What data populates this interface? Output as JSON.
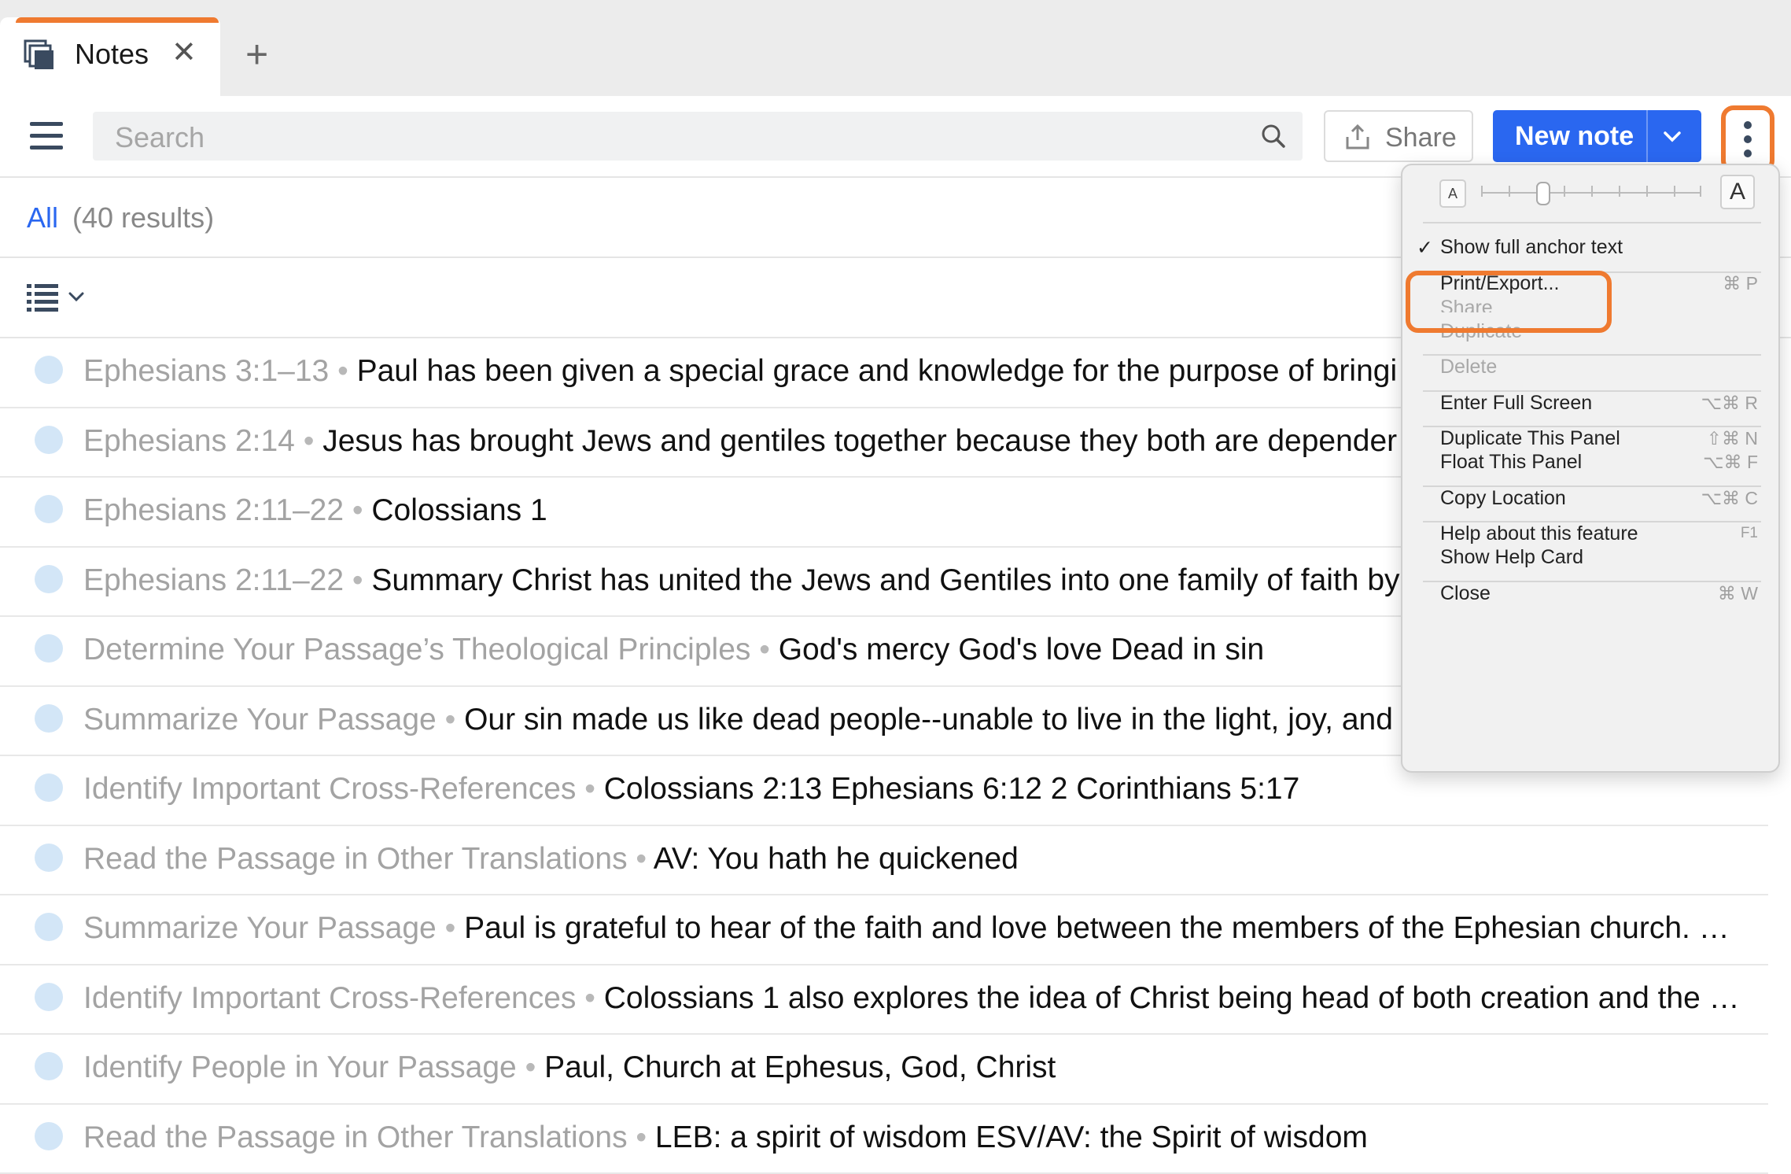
{
  "colors": {
    "accent_orange": "#ef7a30",
    "primary_blue": "#2a67f0",
    "anchor_gray": "#a3a3a3",
    "status_circle": "#d3e6f7"
  },
  "tab": {
    "title": "Notes",
    "icon": "notes-stack-icon",
    "close": "✕",
    "add": "+"
  },
  "toolbar": {
    "menu_icon": "hamburger-icon",
    "search_placeholder": "Search",
    "search_icon": "search-icon",
    "share_label": "Share",
    "share_icon": "share-upload-icon",
    "new_note_label": "New note",
    "new_note_dropdown_icon": "chevron-down-icon",
    "more_icon": "vertical-ellipsis-icon"
  },
  "filter": {
    "all_label": "All",
    "count": "(40 results)",
    "view_icon": "list-view-icon"
  },
  "notes": [
    {
      "anchor": "Ephesians 3:1–13",
      "content": "Paul has been given a special grace and knowledge for the purpose of bringi"
    },
    {
      "anchor": "Ephesians 2:14",
      "content": "Jesus has brought Jews and gentiles together because they both are depender"
    },
    {
      "anchor": "Ephesians 2:11–22",
      "content": "Colossians 1"
    },
    {
      "anchor": "Ephesians 2:11–22",
      "content": "Summary Christ has united the Jews and Gentiles into one family of faith by"
    },
    {
      "anchor": "Determine Your Passage’s Theological Principles",
      "content": "God's mercy God's love Dead in sin"
    },
    {
      "anchor": "Summarize Your Passage",
      "content": "Our sin made us like dead people--unable to live in the light, joy, and"
    },
    {
      "anchor": "Identify Important Cross-References",
      "content": "Colossians 2:13 Ephesians 6:12 2 Corinthians 5:17"
    },
    {
      "anchor": "Read the Passage in Other Translations",
      "content": "AV: You hath he quickened"
    },
    {
      "anchor": "Summarize Your Passage",
      "content": "Paul is grateful to hear of the faith and love between the members of the Ephesian church. …"
    },
    {
      "anchor": "Identify Important Cross-References",
      "content": "Colossians 1 also explores the idea of Christ being head of both creation and the …"
    },
    {
      "anchor": "Identify People in Your Passage",
      "content": "Paul, Church at Ephesus, God, Christ"
    },
    {
      "anchor": "Read the Passage in Other Translations",
      "content": "LEB: a spirit of wisdom ESV/AV: the Spirit of wisdom"
    }
  ],
  "menu": {
    "zoom_small": "A",
    "zoom_large": "A",
    "show_anchor": {
      "check": "✓",
      "label": "Show full anchor text"
    },
    "print_export": {
      "label": "Print/Export...",
      "shortcut": "⌘ P"
    },
    "share": {
      "label": "Share"
    },
    "duplicate": {
      "label": "Duplicate"
    },
    "delete": {
      "label": "Delete"
    },
    "full_screen": {
      "label": "Enter Full Screen",
      "shortcut": "⌥⌘ R"
    },
    "duplicate_panel": {
      "label": "Duplicate This Panel",
      "shortcut": "⇧⌘ N"
    },
    "float_panel": {
      "label": "Float This Panel",
      "shortcut": "⌥⌘ F"
    },
    "copy_location": {
      "label": "Copy Location",
      "shortcut": "⌥⌘ C"
    },
    "help_feature": {
      "label": "Help about this feature",
      "shortcut": "F1"
    },
    "help_card": {
      "label": "Show Help Card"
    },
    "close": {
      "label": "Close",
      "shortcut": "⌘ W"
    }
  }
}
